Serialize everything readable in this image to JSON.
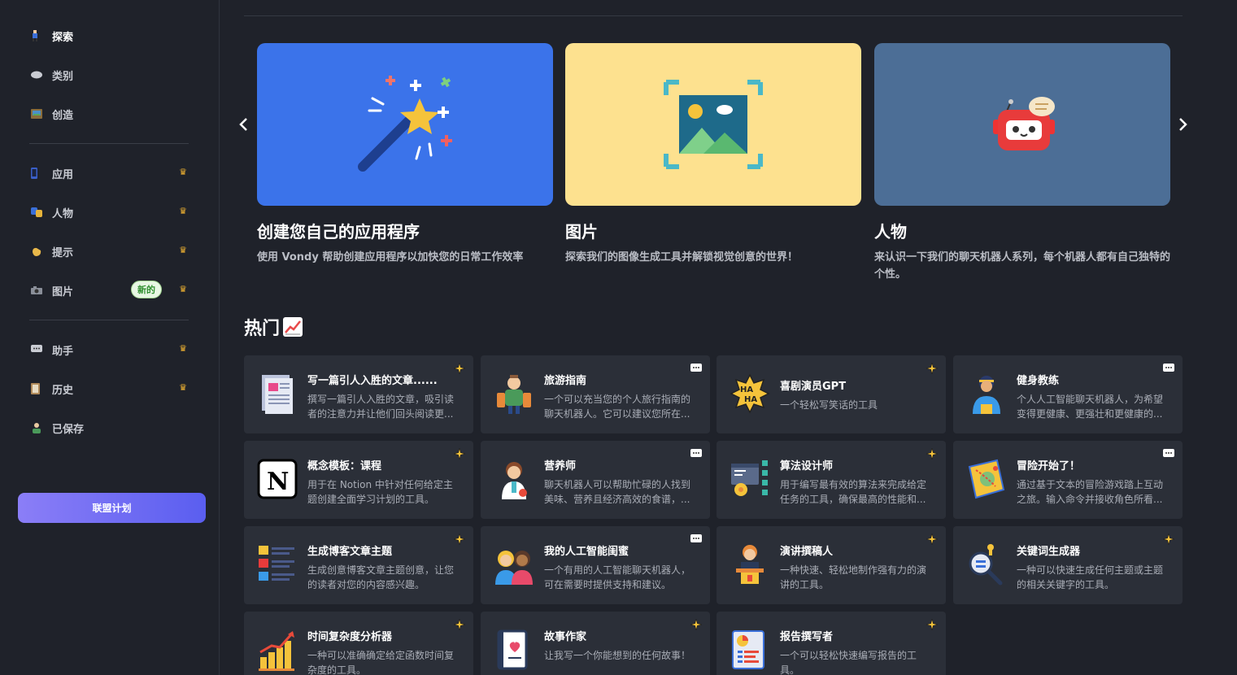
{
  "sidebar": {
    "items": [
      {
        "label": "探索",
        "icon": "explore-icon",
        "active": true
      },
      {
        "label": "类别",
        "icon": "category-icon"
      },
      {
        "label": "创造",
        "icon": "create-icon"
      },
      {
        "label": "应用",
        "icon": "apps-icon",
        "crown": true
      },
      {
        "label": "人物",
        "icon": "characters-icon",
        "crown": true
      },
      {
        "label": "提示",
        "icon": "prompts-icon",
        "crown": true
      },
      {
        "label": "图片",
        "icon": "images-icon",
        "crown": true,
        "badge": "新的"
      },
      {
        "label": "助手",
        "icon": "assistant-icon",
        "crown": true
      },
      {
        "label": "历史",
        "icon": "history-icon",
        "crown": true
      },
      {
        "label": "已保存",
        "icon": "saved-icon"
      }
    ],
    "affiliate_label": "联盟计划"
  },
  "carousel": {
    "prev": "‹",
    "next": "›",
    "features": [
      {
        "title": "创建您自己的应用程序",
        "desc": "使用 Vondy 帮助创建应用程序以加快您的日常工作效率",
        "bg": "#3b73ea"
      },
      {
        "title": "图片",
        "desc": "探索我们的图像生成工具并解锁视觉创意的世界！",
        "bg": "#fde18f"
      },
      {
        "title": "人物",
        "desc": "来认识一下我们的聊天机器人系列，每个机器人都有自己独特的个性。",
        "bg": "#4c6e96"
      }
    ]
  },
  "popular": {
    "title": "热门",
    "cards": [
      {
        "title": "写一篇引人入胜的文章......",
        "desc": "撰写一篇引人入胜的文章，吸引读者的注意力并让他们回头阅读更...",
        "badge": "sparkle"
      },
      {
        "title": "旅游指南",
        "desc": "一个可以充当您的个人旅行指南的聊天机器人。它可以建议您所在...",
        "badge": "chat"
      },
      {
        "title": "喜剧演员GPT",
        "desc": "一个轻松写笑话的工具",
        "badge": "sparkle"
      },
      {
        "title": "健身教练",
        "desc": "个人人工智能聊天机器人，为希望变得更健康、更强壮和更健康的...",
        "badge": "chat"
      },
      {
        "title": "概念模板：课程",
        "desc": "用于在 Notion 中针对任何给定主题创建全面学习计划的工具。",
        "badge": "sparkle"
      },
      {
        "title": "营养师",
        "desc": "聊天机器人可以帮助忙碌的人找到美味、营养且经济高效的食谱，...",
        "badge": "chat"
      },
      {
        "title": "算法设计师",
        "desc": "用于编写最有效的算法来完成给定任务的工具，确保最高的性能和...",
        "badge": "sparkle"
      },
      {
        "title": "冒险开始了！",
        "desc": "通过基于文本的冒险游戏踏上互动之旅。输入命令并接收角色所看...",
        "badge": "chat"
      },
      {
        "title": "生成博客文章主题",
        "desc": "生成创意博客文章主题创意，让您的读者对您的内容感兴趣。",
        "badge": "sparkle"
      },
      {
        "title": "我的人工智能闺蜜",
        "desc": "一个有用的人工智能聊天机器人，可在需要时提供支持和建议。",
        "badge": "chat"
      },
      {
        "title": "演讲撰稿人",
        "desc": "一种快速、轻松地制作强有力的演讲的工具。",
        "badge": "sparkle"
      },
      {
        "title": "关键词生成器",
        "desc": "一种可以快速生成任何主题或主题的相关关键字的工具。",
        "badge": "sparkle"
      },
      {
        "title": "时间复杂度分析器",
        "desc": "一种可以准确确定给定函数时间复杂度的工具。",
        "badge": "sparkle"
      },
      {
        "title": "故事作家",
        "desc": "让我写一个你能想到的任何故事！",
        "badge": "sparkle"
      },
      {
        "title": "报告撰写者",
        "desc": "一个可以轻松快速编写报告的工具。",
        "badge": "sparkle"
      }
    ]
  }
}
